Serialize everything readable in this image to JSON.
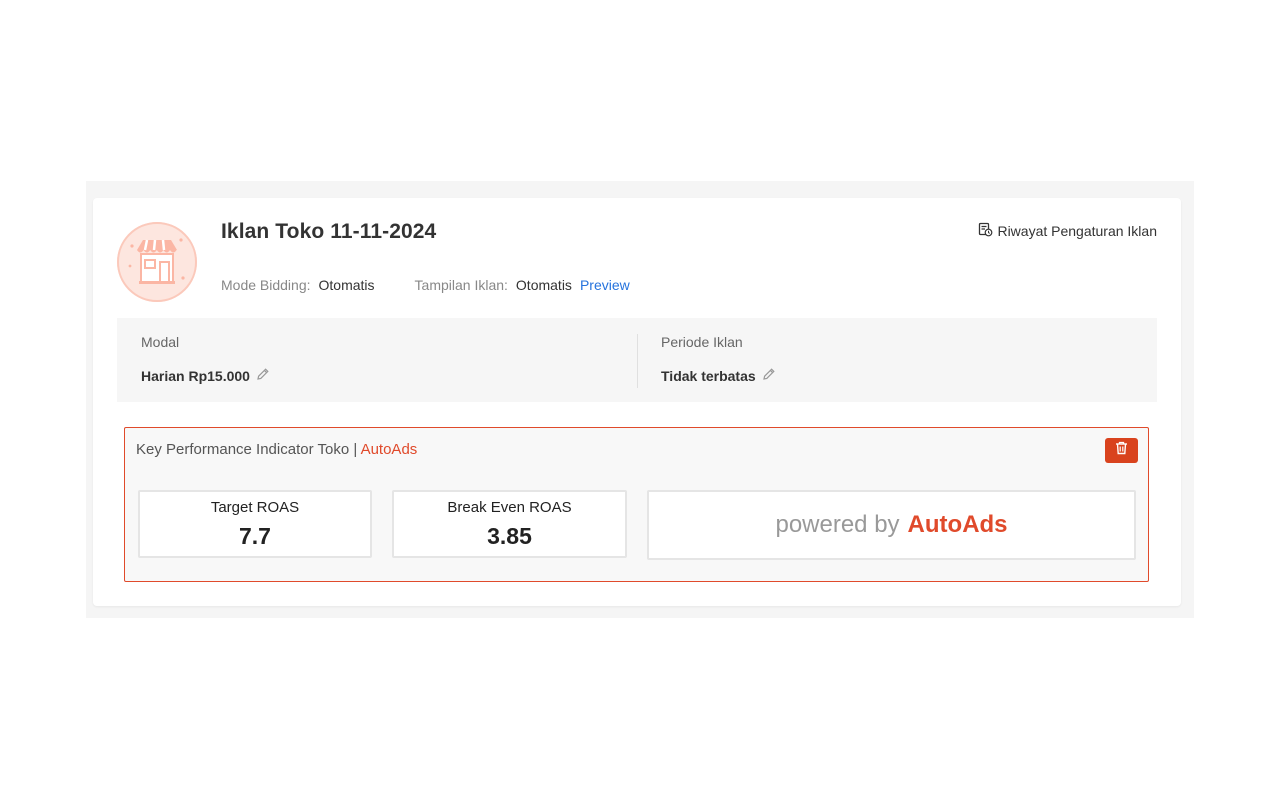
{
  "campaign": {
    "title": "Iklan Toko 11-11-2024",
    "avatar_icon": "shop-icon",
    "meta": {
      "bidding_label": "Mode Bidding:",
      "bidding_value": "Otomatis",
      "display_label": "Tampilan Iklan:",
      "display_value": "Otomatis",
      "preview_link": "Preview"
    },
    "history_link": "Riwayat Pengaturan Iklan"
  },
  "info": {
    "budget_label": "Modal",
    "budget_value": "Harian Rp15.000",
    "period_label": "Periode Iklan",
    "period_value": "Tidak terbatas"
  },
  "kpi": {
    "title": "Key Performance Indicator Toko |",
    "brand": "AutoAds",
    "metrics": [
      {
        "label": "Target ROAS",
        "value": "7.7"
      },
      {
        "label": "Break Even ROAS",
        "value": "3.85"
      }
    ],
    "powered_text": "powered by",
    "powered_brand": "AutoAds"
  },
  "colors": {
    "accent": "#e04a2b",
    "link": "#2673dd",
    "delete_button": "#d9431e"
  }
}
